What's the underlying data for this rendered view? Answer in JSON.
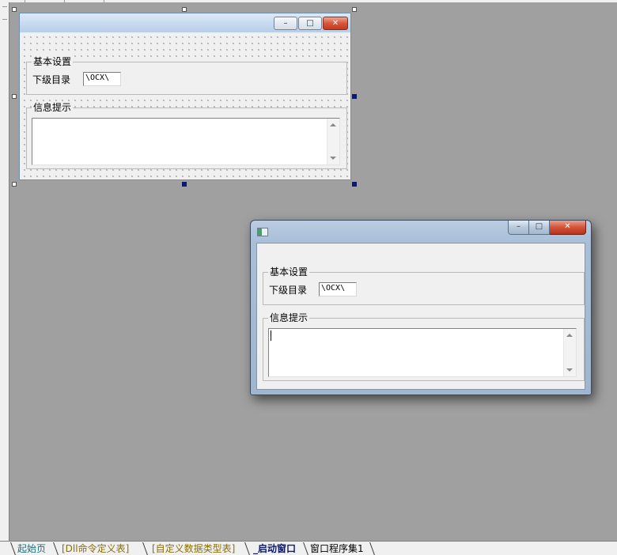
{
  "design_form": {
    "group_basic": {
      "legend": "基本设置",
      "field_label": "下级目录",
      "field_value": "\\OCX\\"
    },
    "group_info": {
      "legend": "信息提示",
      "memo_value": ""
    },
    "caption_buttons": {
      "min_icon": "minimize-icon",
      "max_icon": "maximize-icon",
      "close_icon": "close-icon"
    }
  },
  "runtime_window": {
    "title": "",
    "group_basic": {
      "legend": "基本设置",
      "field_label": "下级目录",
      "field_value": "\\OCX\\"
    },
    "group_info": {
      "legend": "信息提示",
      "memo_value": ""
    }
  },
  "tabs": [
    {
      "label": "起始页",
      "active": false
    },
    {
      "label": "[Dll命令定义表]",
      "active": false
    },
    {
      "label": "[自定义数据类型表]",
      "active": false
    },
    {
      "label": "_启动窗口",
      "active": true
    },
    {
      "label": "窗口程序集1",
      "active": false
    }
  ],
  "colors": {
    "canvas": "#a0a0a0",
    "form_bg": "#f0f0f0",
    "active_tab": "#0b1a6a",
    "home_tab": "#1f6f7a",
    "ref_tab": "#8a6f00",
    "close_button": "#d45337"
  }
}
